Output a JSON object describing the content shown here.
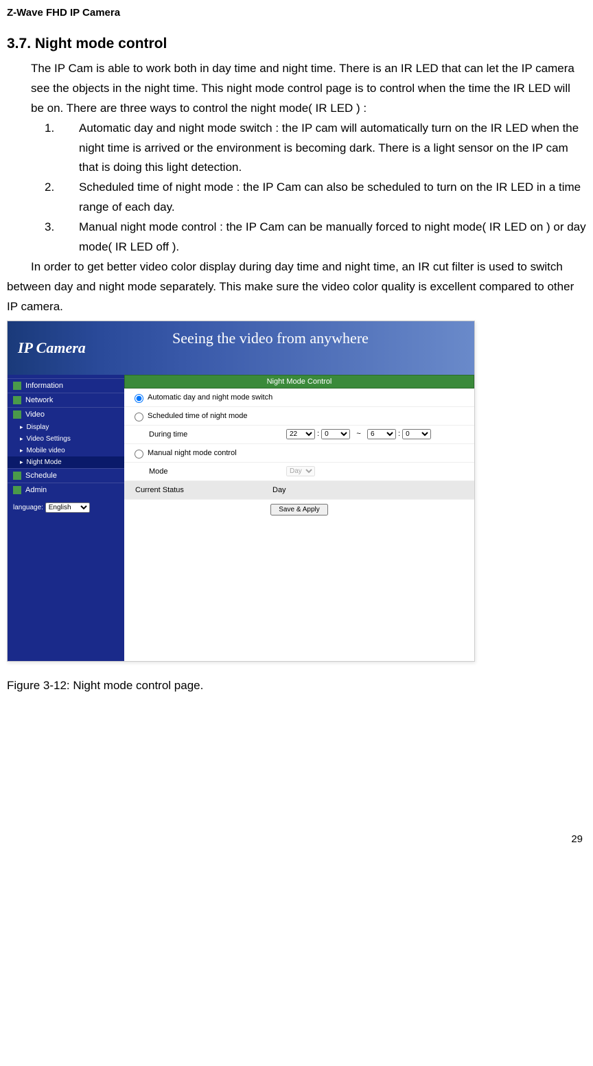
{
  "header": "Z-Wave FHD IP Camera",
  "section_title": "3.7. Night mode control",
  "intro": "The IP Cam is able to work both in day time and night time. There is an IR LED that can let the IP camera see the objects in the night time. This night mode control page is to control when the time the IR LED will be on. There are three ways to control the night mode( IR LED ) :",
  "list": [
    {
      "num": "1.",
      "text": "Automatic day and night mode switch : the IP cam will automatically turn on the IR LED when the night time is arrived or the environment is becoming dark. There is a light sensor on the IP cam that is doing this light detection."
    },
    {
      "num": "2.",
      "text": "Scheduled time of night mode : the IP Cam can also be scheduled to turn on the IR LED in a time range of each day."
    },
    {
      "num": "3.",
      "text": "Manual night mode control : the IP Cam can be manually forced to night mode( IR LED on ) or day mode( IR LED off )."
    }
  ],
  "outro": "In order to get better video color display during day time and night time, an IR cut filter is used to switch between day and night mode separately. This make sure the video color quality is excellent compared to other IP camera.",
  "figure_caption": "Figure 3-12: Night mode control page.",
  "page_num": "29",
  "screenshot": {
    "banner_title": "IP Camera",
    "banner_slogan": "Seeing the video from anywhere",
    "nav": {
      "information": "Information",
      "network": "Network",
      "video": "Video",
      "display": "Display",
      "video_settings": "Video Settings",
      "mobile_video": "Mobile video",
      "night_mode": "Night Mode",
      "schedule": "Schedule",
      "admin": "Admin"
    },
    "lang_label": "language:",
    "lang_value": "English",
    "panel_title": "Night Mode Control",
    "form": {
      "opt1": "Automatic day and night mode switch",
      "opt2": "Scheduled time of night mode",
      "during_label": "During time",
      "time_h1": "22",
      "time_m1": "0",
      "time_sep": "~",
      "time_h2": "6",
      "time_m2": "0",
      "opt3": "Manual night mode control",
      "mode_label": "Mode",
      "mode_value": "Day",
      "status_label": "Current Status",
      "status_value": "Day",
      "save_btn": "Save & Apply"
    }
  }
}
